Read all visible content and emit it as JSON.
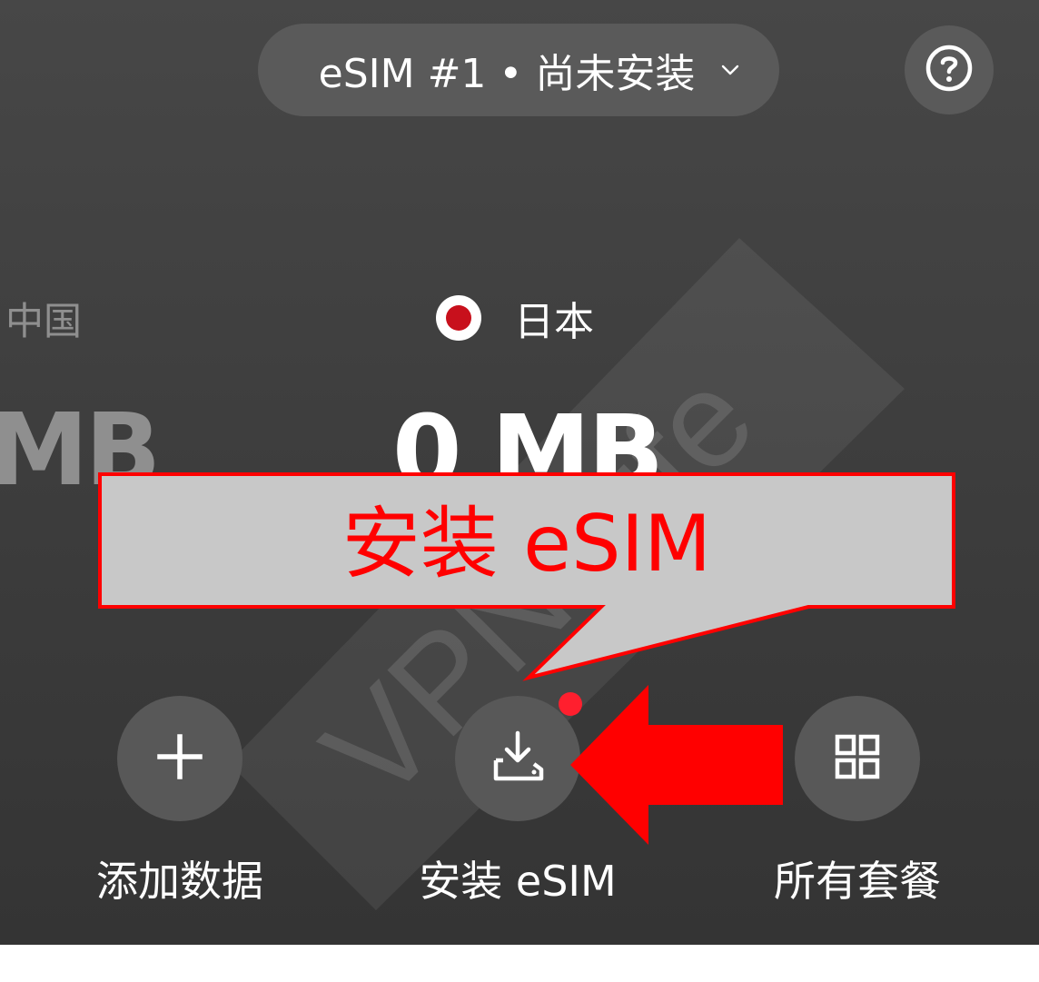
{
  "header": {
    "selector_label": "eSIM #1 • 尚未安装",
    "help_icon": "question-circle-icon"
  },
  "carousel": {
    "prev_country": "中国",
    "prev_data": "MB",
    "current_country": "日本",
    "current_data": "0 MB",
    "flag_colors": {
      "background": "#ffffff",
      "circle": "#c8101c"
    },
    "page_count": 3
  },
  "annotation": {
    "callout_text": "安装 eSIM",
    "callout_color": "#ff0000",
    "callout_fill": "#c8c8c8",
    "arrow_color": "#ff0000"
  },
  "watermark": {
    "text": "VPN Life"
  },
  "actions": [
    {
      "label": "添加数据",
      "icon": "plus-icon"
    },
    {
      "label": "安装 eSIM",
      "icon": "download-icon"
    },
    {
      "label": "所有套餐",
      "icon": "grid-icon"
    }
  ],
  "colors": {
    "accent_dot": "#ff1f2e"
  }
}
